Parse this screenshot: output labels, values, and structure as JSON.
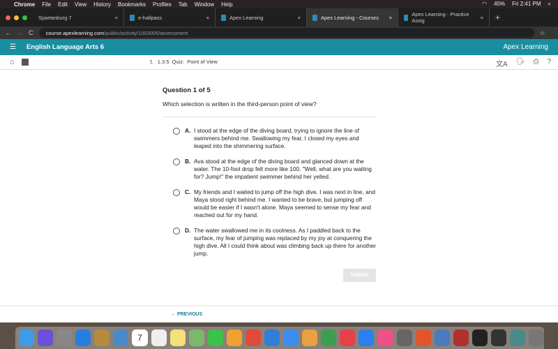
{
  "menubar": {
    "app": "Chrome",
    "items": [
      "File",
      "Edit",
      "View",
      "History",
      "Bookmarks",
      "Profiles",
      "Tab",
      "Window",
      "Help"
    ],
    "battery": "45%",
    "clock": "Fri 2:41 PM"
  },
  "tabs": [
    {
      "label": "Spartanburg 7",
      "active": false
    },
    {
      "label": "e-hallpass",
      "active": false
    },
    {
      "label": "Apex Learning",
      "active": false
    },
    {
      "label": "Apex Learning - Courses",
      "active": true
    },
    {
      "label": "Apex Learning - Practice Assig",
      "active": false
    }
  ],
  "address": {
    "host": "course.apexlearning.com",
    "path": "/public/activity/1003005/assessment"
  },
  "header": {
    "title": "English Language Arts 6",
    "logo": "Apex Learning",
    "accent": "#1a8ea1"
  },
  "toolbar": {
    "section": "1.3.5",
    "type": "Quiz:",
    "name": "Point of View"
  },
  "question": {
    "heading": "Question 1 of 5",
    "text": "Which selection is written in the third-person point of view?",
    "options": [
      {
        "letter": "A.",
        "text": "I stood at the edge of the diving board, trying to ignore the line of swimmers behind me. Swallowing my fear, I closed my eyes and leaped into the shimmering surface."
      },
      {
        "letter": "B.",
        "text": "Ava stood at the edge of the diving board and glanced down at the water. The 10-foot drop felt more like 100. \"Well, what are you waiting for? Jump!\" the impatient swimmer behind her yelled."
      },
      {
        "letter": "C.",
        "text": "My friends and I waited to jump off the high dive. I was next in line, and Maya stood right behind me. I wanted to be brave, but jumping off would be easier if I wasn't alone. Maya seemed to sense my fear and reached out for my hand."
      },
      {
        "letter": "D.",
        "text": "The water swallowed me in its coolness. As I paddled back to the surface, my fear of jumping was replaced by my joy at conquering the high dive. All I could think about was climbing back up there for another jump."
      }
    ]
  },
  "submit_label": "SUBMIT",
  "previous_label": "PREVIOUS",
  "dock": [
    "finder",
    "siri",
    "launchpad",
    "safari",
    "contacts",
    "preview",
    "calendar",
    "reminders",
    "notes",
    "maps",
    "facetime",
    "photos",
    "chrome",
    "keynote",
    "messages",
    "pages",
    "numbers",
    "news",
    "app-store",
    "music",
    "system-preferences",
    "powerpoint",
    "preview-2",
    "dictionary",
    "window-1",
    "window-2",
    "window-3",
    "trash"
  ],
  "calendar_day": "7"
}
